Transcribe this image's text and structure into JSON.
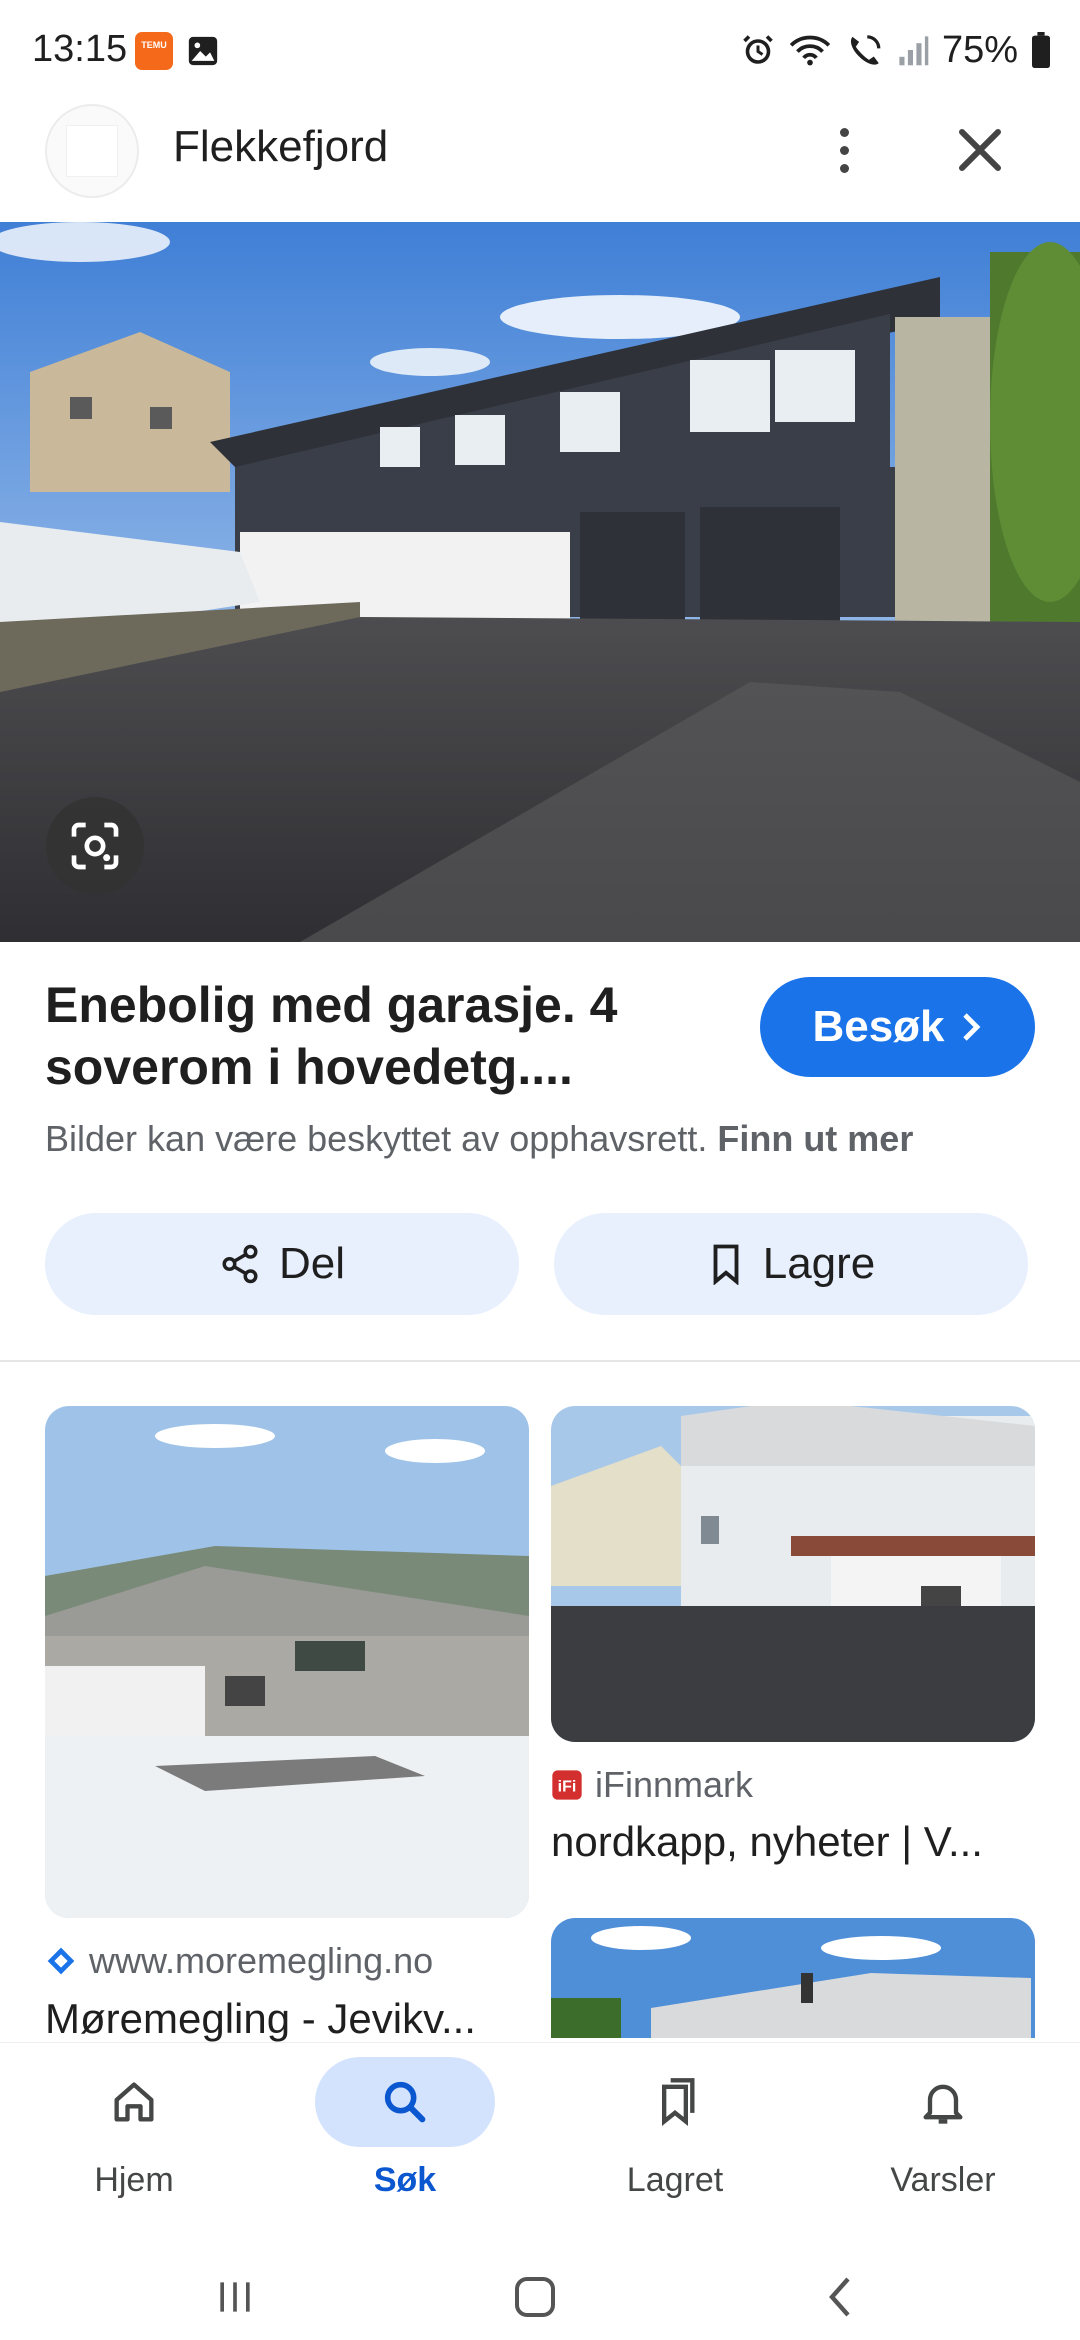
{
  "status_bar": {
    "time": "13:15",
    "temu_label": "TEMU",
    "battery": "75%",
    "icons": [
      "temu-app-icon",
      "gallery-icon",
      "alarm-icon",
      "wifi-icon",
      "wifi-calling-icon",
      "signal-icon",
      "battery-icon"
    ]
  },
  "topbar": {
    "title": "Flekkefjord",
    "icons": [
      "site-favicon",
      "more-vert-icon",
      "close-icon"
    ]
  },
  "result": {
    "title": "Enebolig med garasje. 4 soverom i hovedetg....",
    "visit_label": "Besøk",
    "copyright_text": "Bilder kan være beskyttet av opphavsrett.",
    "learn_more": "Finn ut mer"
  },
  "actions": {
    "share_label": "Del",
    "save_label": "Lagre"
  },
  "related": [
    {
      "source": "www.moremegling.no",
      "title": "Møremegling - Jevikv..."
    },
    {
      "source": "iFinnmark",
      "title": "nordkapp, nyheter | V..."
    }
  ],
  "bottom_nav": {
    "items": [
      {
        "label": "Hjem",
        "icon": "home-icon"
      },
      {
        "label": "Søk",
        "icon": "search-icon"
      },
      {
        "label": "Lagret",
        "icon": "bookmarks-icon"
      },
      {
        "label": "Varsler",
        "icon": "bell-icon"
      }
    ],
    "active": "Søk",
    "accent": "#0b57d0"
  },
  "colors": {
    "primary": "#1a73e8",
    "chip_bg": "#e8f0fe",
    "nav_active_bg": "#d3e3fd"
  }
}
